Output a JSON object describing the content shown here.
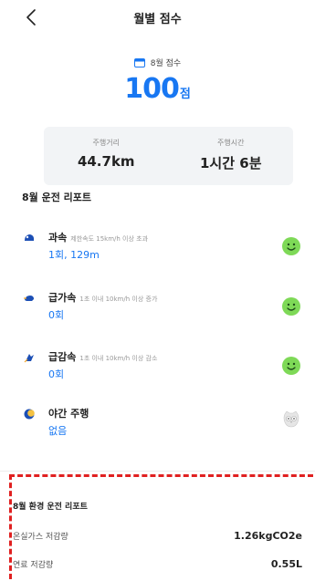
{
  "header": {
    "title": "월별 점수"
  },
  "score": {
    "period_label": "8월 점수",
    "value": "100",
    "unit": "점"
  },
  "stats": {
    "distance": {
      "label": "주행거리",
      "value": "44.7km"
    },
    "time": {
      "label": "주행시간",
      "value": "1시간 6분"
    }
  },
  "report": {
    "title": "8월 운전 리포트",
    "items": [
      {
        "title": "과속",
        "desc": "제한속도 15km/h 이상 초과",
        "value": "1회, 129m",
        "face": "happy-face",
        "icon": "speed-icon"
      },
      {
        "title": "급가속",
        "desc": "1초 이내 10km/h 이상 증가",
        "value": "0회",
        "face": "happy-face",
        "icon": "acceleration-icon"
      },
      {
        "title": "급감속",
        "desc": "1초 이내 10km/h 이상 감소",
        "value": "0회",
        "face": "happy-face",
        "icon": "deceleration-icon"
      },
      {
        "title": "야간 주행",
        "desc": "",
        "value": "없음",
        "face": "owl-face",
        "icon": "moon-icon"
      }
    ]
  },
  "environment": {
    "title": "8월 환경 운전 리포트",
    "rows": [
      {
        "label": "온실가스 저감량",
        "value": "1.26kgCO2e"
      },
      {
        "label": "연료 저감량",
        "value": "0.55L"
      }
    ]
  },
  "colors": {
    "accent": "#1877f2",
    "positive_face": "#7ed957",
    "highlight_border": "#e02020"
  }
}
